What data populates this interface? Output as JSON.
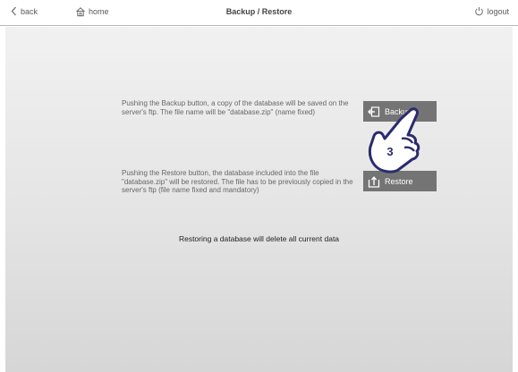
{
  "header": {
    "back_label": "back",
    "home_label": "home",
    "title": "Backup / Restore",
    "logout_label": "logout",
    "icons": {
      "back": "chevron-left-icon",
      "home": "home-icon",
      "logout": "power-icon"
    }
  },
  "backup": {
    "description": "Pushing the Backup button, a copy of the database will be saved on the server's ftp. The file name will be \"database.zip\" (name fixed)",
    "button_label": "Backup",
    "icon": "backup-icon"
  },
  "restore": {
    "description": "Pushing the Restore button, the database included into the file \"database.zip\" will be restored. The file has to be previously copied in the server's ftp (file name fixed and mandatory)",
    "button_label": "Restore",
    "icon": "restore-icon"
  },
  "warning_text": "Restoring a database will delete all current data",
  "pointer_step": "3",
  "colors": {
    "button_bg": "#747474",
    "panel_top": "#f1f1f1",
    "panel_bottom": "#d6d6d6",
    "pointer_border": "#2b2b6e"
  }
}
